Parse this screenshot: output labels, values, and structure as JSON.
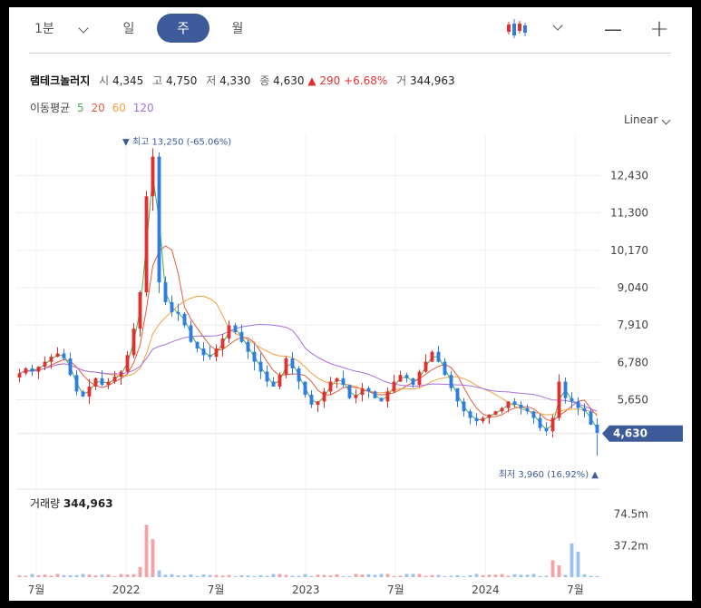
{
  "toolbar": {
    "interval": "1분",
    "tabs": [
      "일",
      "주",
      "월"
    ],
    "active_tab": "주",
    "zoom_out": "—",
    "zoom_in": "+"
  },
  "stock": {
    "name": "램테크놀러지",
    "open_label": "시",
    "open": "4,345",
    "high_label": "고",
    "high": "4,750",
    "low_label": "저",
    "low": "4,330",
    "close_label": "종",
    "close": "4,630",
    "change": "▲ 290 +6.68%",
    "volume_label": "거",
    "volume": "344,963"
  },
  "moving_average": {
    "label": "이동평균",
    "periods": [
      {
        "value": "5",
        "color": "#4caf50"
      },
      {
        "value": "20",
        "color": "#e05c3b"
      },
      {
        "value": "60",
        "color": "#f0a040"
      },
      {
        "value": "120",
        "color": "#a770e0"
      }
    ]
  },
  "scale_mode": "Linear",
  "colors": {
    "up": "#e03131",
    "down": "#2e7de0",
    "accent": "#3d5a99"
  },
  "chart_data": {
    "type": "candlestick",
    "y_ticks": [
      "12,430",
      "11,300",
      "10,170",
      "9,040",
      "7,910",
      "6,780",
      "5,650"
    ],
    "y_tick_values": [
      12430,
      11300,
      10170,
      9040,
      7910,
      6780,
      5650
    ],
    "ylim": [
      3800,
      13400
    ],
    "current_price_label": "4,630",
    "current_price": 4630,
    "max_annotation": "▼ 최고 13,250 (-65.06%)",
    "max_value": 13250,
    "min_annotation": "최저 3,960 (16.92%) ▲",
    "min_value": 3960,
    "x_ticks": [
      "7월",
      "2022",
      "7월",
      "2023",
      "7월",
      "2024",
      "7월"
    ],
    "x_tick_positions": [
      0,
      0.5,
      1,
      1.5,
      2,
      2.5,
      3
    ],
    "close_series": [
      6450,
      6600,
      6500,
      6650,
      6800,
      6950,
      7050,
      6900,
      6400,
      5900,
      5750,
      6050,
      6300,
      6100,
      6200,
      6350,
      6500,
      7000,
      7800,
      8900,
      11800,
      13000,
      9200,
      8600,
      8300,
      8250,
      7900,
      7400,
      7200,
      7000,
      6950,
      7200,
      7500,
      7900,
      7700,
      7400,
      7100,
      6800,
      6500,
      6200,
      6050,
      6400,
      6900,
      6600,
      6200,
      5800,
      5500,
      5600,
      5900,
      6200,
      6300,
      6100,
      5700,
      5800,
      6000,
      5900,
      5700,
      5600,
      5900,
      6200,
      6400,
      6300,
      6100,
      6500,
      6800,
      7100,
      6800,
      6400,
      6000,
      5600,
      5300,
      5100,
      5000,
      5100,
      5200,
      5300,
      5400,
      5600,
      5500,
      5400,
      5300,
      5100,
      4800,
      4700,
      5100,
      6200,
      5700,
      5600,
      5400,
      5300,
      4900,
      4630
    ],
    "volume": {
      "label": "거래량",
      "value": "344,963",
      "y_ticks": [
        "74.5m",
        "37.2m"
      ],
      "y_tick_values": [
        74.5,
        37.2
      ],
      "unit": "m"
    }
  }
}
